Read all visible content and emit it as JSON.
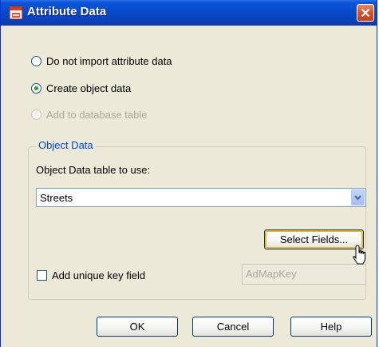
{
  "window": {
    "title": "Attribute Data"
  },
  "import_options": [
    {
      "label": "Do not import attribute data",
      "selected": false,
      "enabled": true
    },
    {
      "label": "Create object data",
      "selected": true,
      "enabled": true
    },
    {
      "label": "Add to database table",
      "selected": false,
      "enabled": false
    }
  ],
  "object_data": {
    "group_label": "Object Data",
    "table_label": "Object Data table to use:",
    "table_value": "Streets",
    "select_fields_label": "Select Fields...",
    "unique_key_label": "Add unique key field",
    "unique_key_checked": false,
    "key_field_value": "AdMapKey"
  },
  "footer": {
    "ok_label": "OK",
    "cancel_label": "Cancel",
    "help_label": "Help"
  }
}
